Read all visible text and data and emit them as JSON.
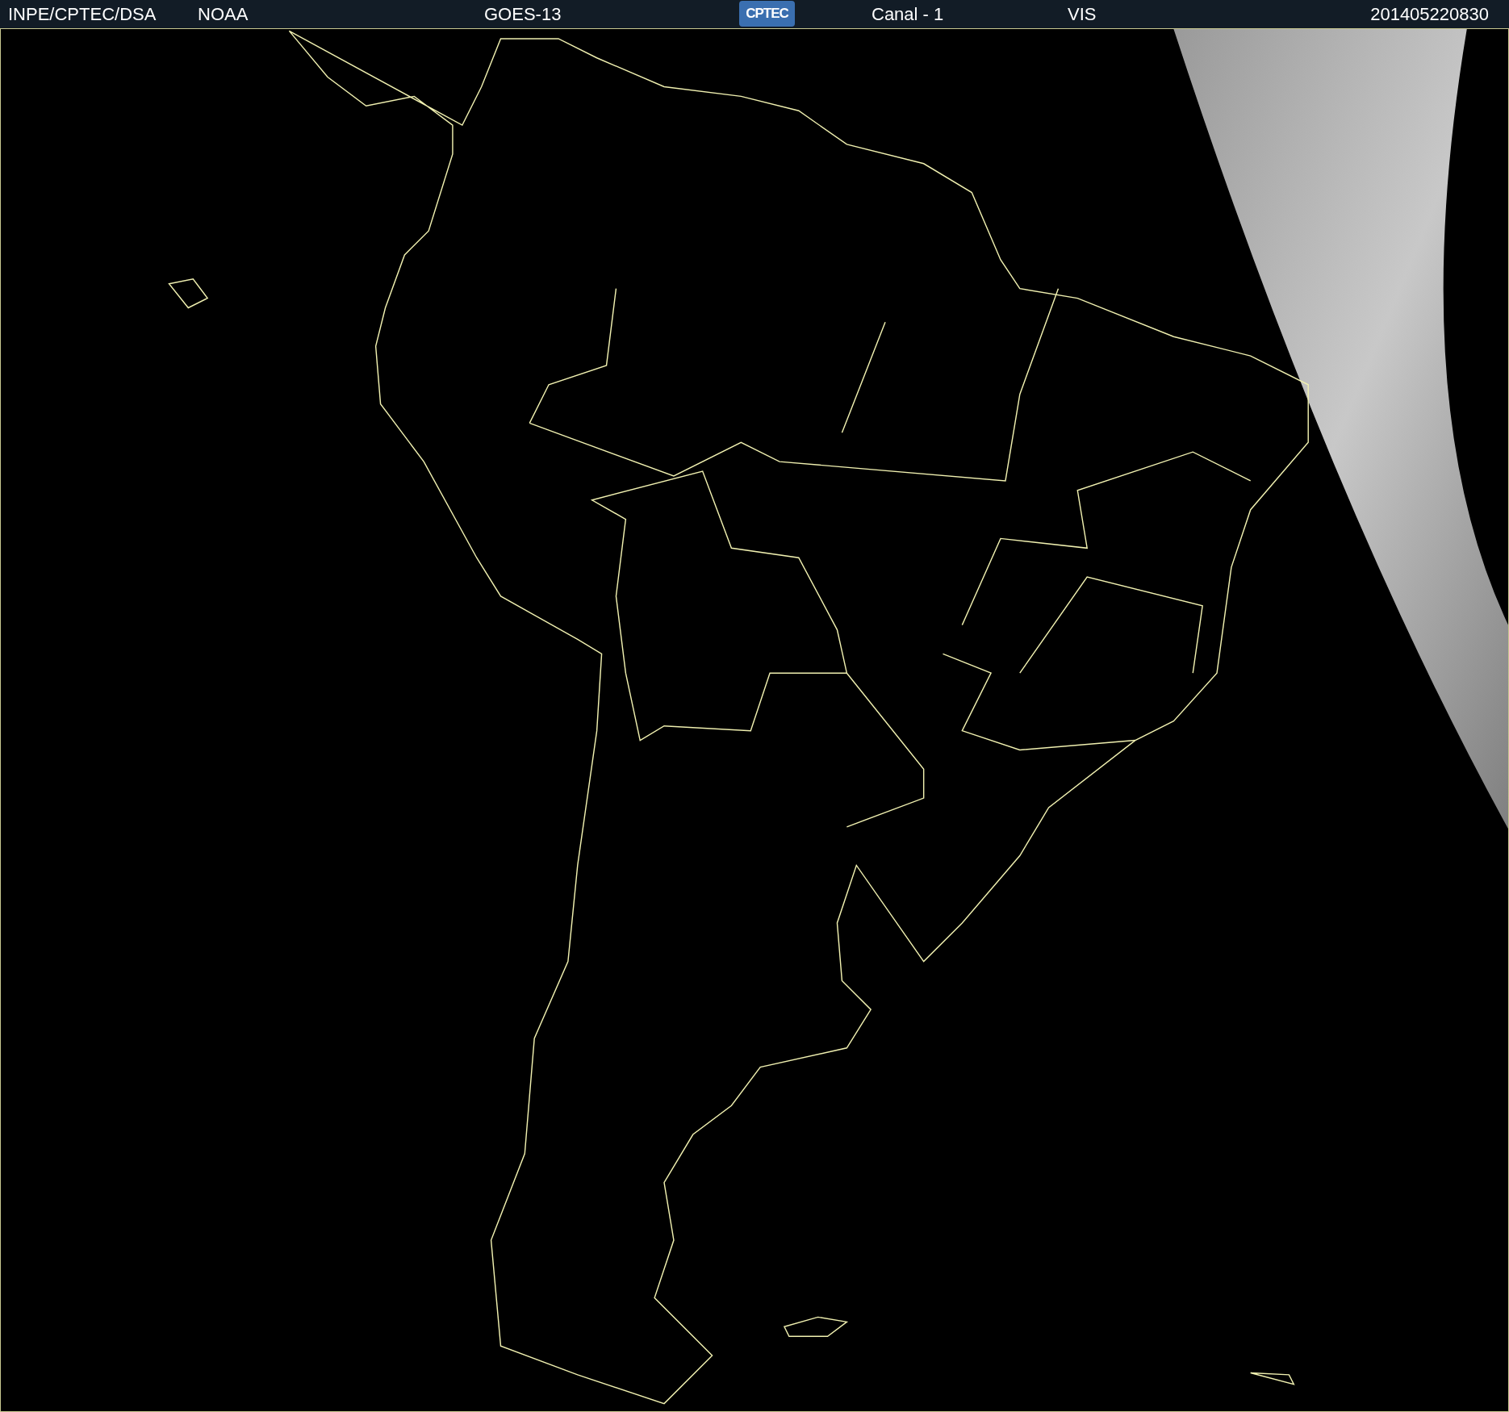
{
  "header": {
    "items": [
      "INPE/CPTEC/DSA",
      "NOAA",
      "GOES-13"
    ],
    "logo": "CPTEC",
    "items_right": [
      "Canal - 1",
      "VIS"
    ],
    "timestamp": "201405220830"
  }
}
